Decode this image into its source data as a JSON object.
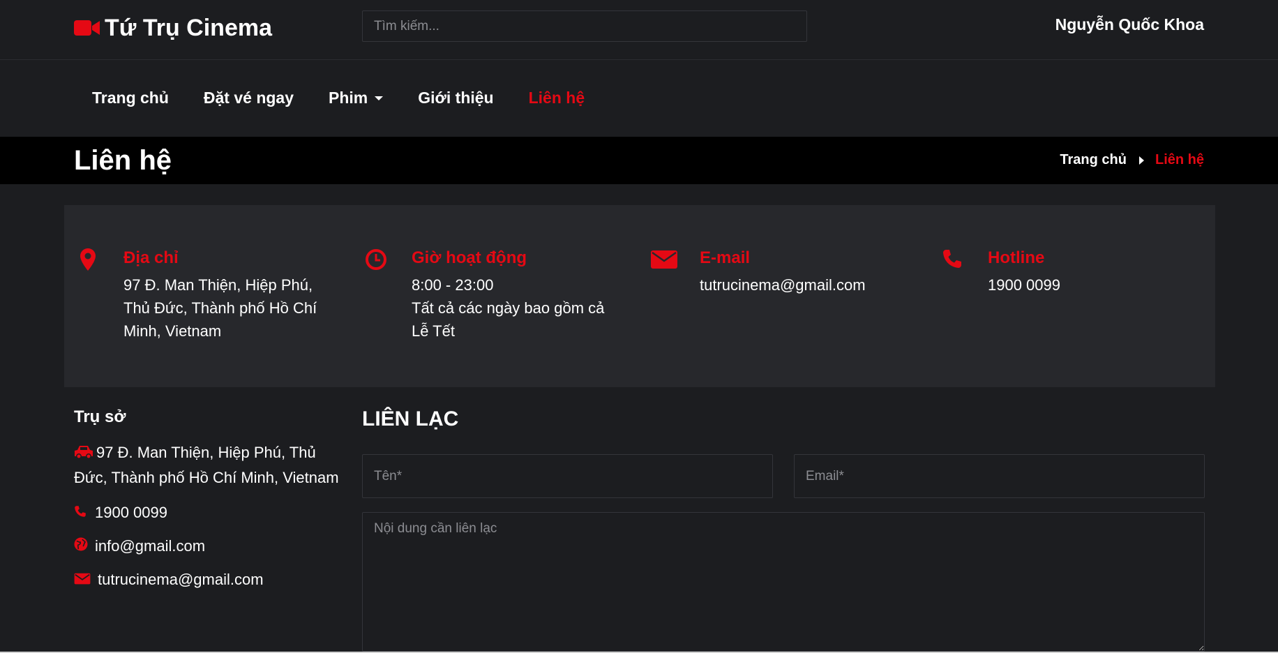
{
  "header": {
    "brand": "Tứ Trụ Cinema",
    "search_placeholder": "Tìm kiếm...",
    "user_name": "Nguyễn Quốc Khoa"
  },
  "nav": {
    "items": [
      {
        "label": "Trang chủ"
      },
      {
        "label": "Đặt vé ngay"
      },
      {
        "label": "Phim"
      },
      {
        "label": "Giới thiệu"
      },
      {
        "label": "Liên hệ",
        "active": true
      }
    ]
  },
  "page": {
    "title": "Liên hệ",
    "breadcrumb": [
      "Trang chủ",
      "Liên hệ"
    ]
  },
  "info": [
    {
      "icon": "map-marker-icon",
      "title": "Địa chỉ",
      "lines": [
        "97 Đ. Man Thiện, Hiệp Phú,",
        "Thủ Đức, Thành phố Hồ Chí",
        "Minh, Vietnam"
      ]
    },
    {
      "icon": "clock-icon",
      "title": "Giờ hoạt động",
      "lines": [
        "8:00 - 23:00",
        "Tất cả các ngày bao gồm cả",
        "Lễ Tết"
      ]
    },
    {
      "icon": "envelope-icon",
      "title": "E-mail",
      "lines": [
        "tutrucinema@gmail.com"
      ]
    },
    {
      "icon": "phone-icon",
      "title": "Hotline",
      "lines": [
        "1900 0099"
      ]
    }
  ],
  "hq": {
    "title": "Trụ sở",
    "address": "97 Đ. Man Thiện, Hiệp Phú, Thủ Đức, Thành phố Hồ Chí Minh, Vietnam",
    "phone": "1900 0099",
    "web": "info@gmail.com",
    "email": "tutrucinema@gmail.com"
  },
  "contact": {
    "title": "LIÊN LẠC",
    "name_placeholder": "Tên*",
    "email_placeholder": "Email*",
    "message_placeholder": "Nội dung cần liên lạc"
  },
  "colors": {
    "accent": "#e50914",
    "background": "#1c1d20",
    "panel": "#27282c"
  }
}
